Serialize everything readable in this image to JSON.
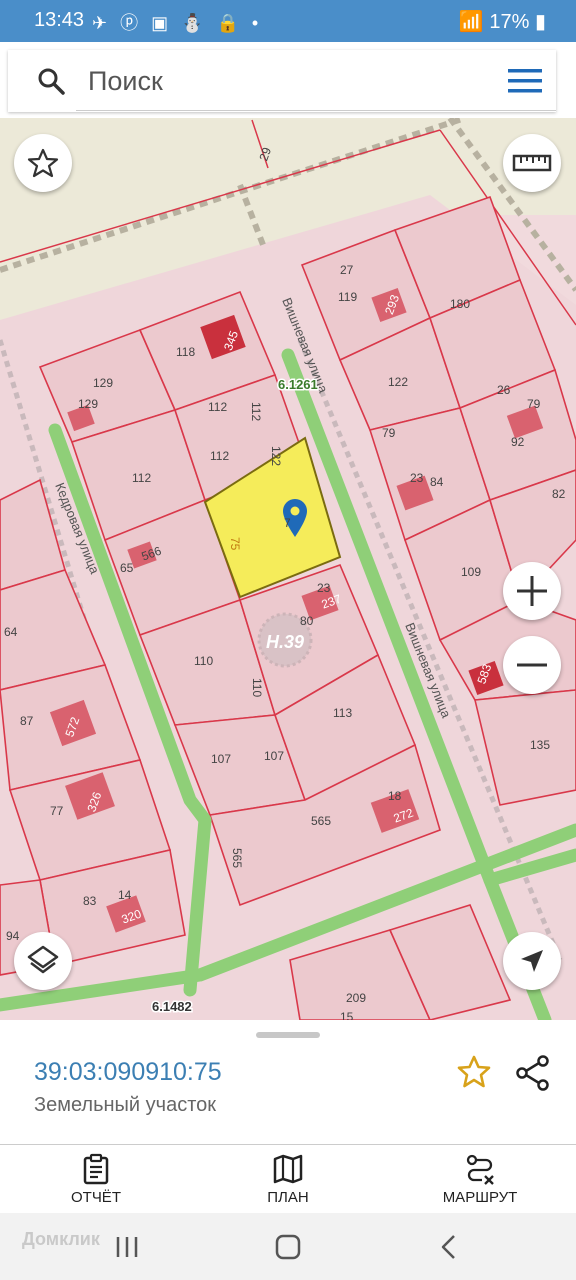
{
  "status": {
    "time": "13:43",
    "battery": "17%",
    "icons": [
      "telegram-icon",
      "pinterest-icon",
      "gallery-icon",
      "accessibility-icon",
      "lock-icon",
      "dot-icon",
      "wifi-icon",
      "signal-icon",
      "battery-icon"
    ]
  },
  "search": {
    "placeholder": "Поиск"
  },
  "map": {
    "street_labels": [
      "Вишневая улица",
      "Вишневая улица",
      "Кедровая улица"
    ],
    "road_codes": [
      "6.1261",
      "6.1482"
    ],
    "marker_label": "Н.39",
    "numbers": [
      "29",
      "27",
      "119",
      "180",
      "118",
      "345",
      "293",
      "129",
      "129",
      "112",
      "112",
      "112",
      "122",
      "122",
      "79",
      "26",
      "79",
      "92",
      "112",
      "23",
      "84",
      "82",
      "65",
      "566",
      "75",
      "7",
      "23",
      "237",
      "80",
      "109",
      "64",
      "110",
      "110",
      "583",
      "135",
      "87",
      "572",
      "107",
      "107",
      "113",
      "77",
      "326",
      "565",
      "565",
      "18",
      "272",
      "83",
      "14",
      "320",
      "94",
      "209",
      "15"
    ],
    "colors": {
      "parcel_fill": "#ecc9ce",
      "parcel_line": "#d9384a",
      "selected_fill": "#f5ec5a",
      "road": "#8fcf78",
      "pin": "#1f6ab8"
    }
  },
  "sheet": {
    "cadastral_number": "39:03:090910:75",
    "type": "Земельный участок"
  },
  "tabs": [
    {
      "label": "ОТЧЁТ",
      "icon": "clipboard-icon"
    },
    {
      "label": "ПЛАН",
      "icon": "map-plan-icon"
    },
    {
      "label": "МАРШРУТ",
      "icon": "route-icon"
    }
  ],
  "navbar": {
    "watermark": "Домклик"
  }
}
